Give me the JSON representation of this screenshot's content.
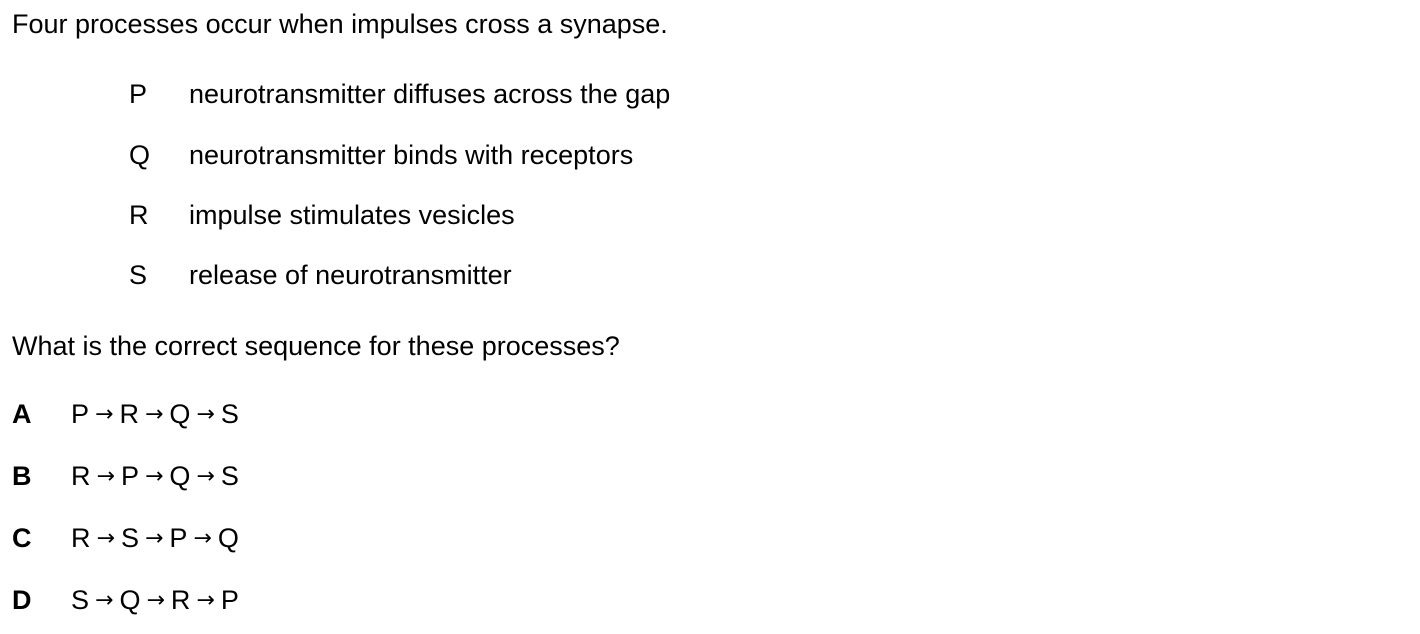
{
  "intro": "Four processes occur when impulses cross a synapse.",
  "processes": [
    {
      "letter": "P",
      "text": "neurotransmitter diffuses across the gap"
    },
    {
      "letter": "Q",
      "text": "neurotransmitter binds with receptors"
    },
    {
      "letter": "R",
      "text": "impulse stimulates vesicles"
    },
    {
      "letter": "S",
      "text": "release of neurotransmitter"
    }
  ],
  "question": "What is the correct sequence for these processes?",
  "arrow": "→",
  "options": [
    {
      "letter": "A",
      "sequence": [
        "P",
        "R",
        "Q",
        "S"
      ]
    },
    {
      "letter": "B",
      "sequence": [
        "R",
        "P",
        "Q",
        "S"
      ]
    },
    {
      "letter": "C",
      "sequence": [
        "R",
        "S",
        "P",
        "Q"
      ]
    },
    {
      "letter": "D",
      "sequence": [
        "S",
        "Q",
        "R",
        "P"
      ]
    }
  ]
}
